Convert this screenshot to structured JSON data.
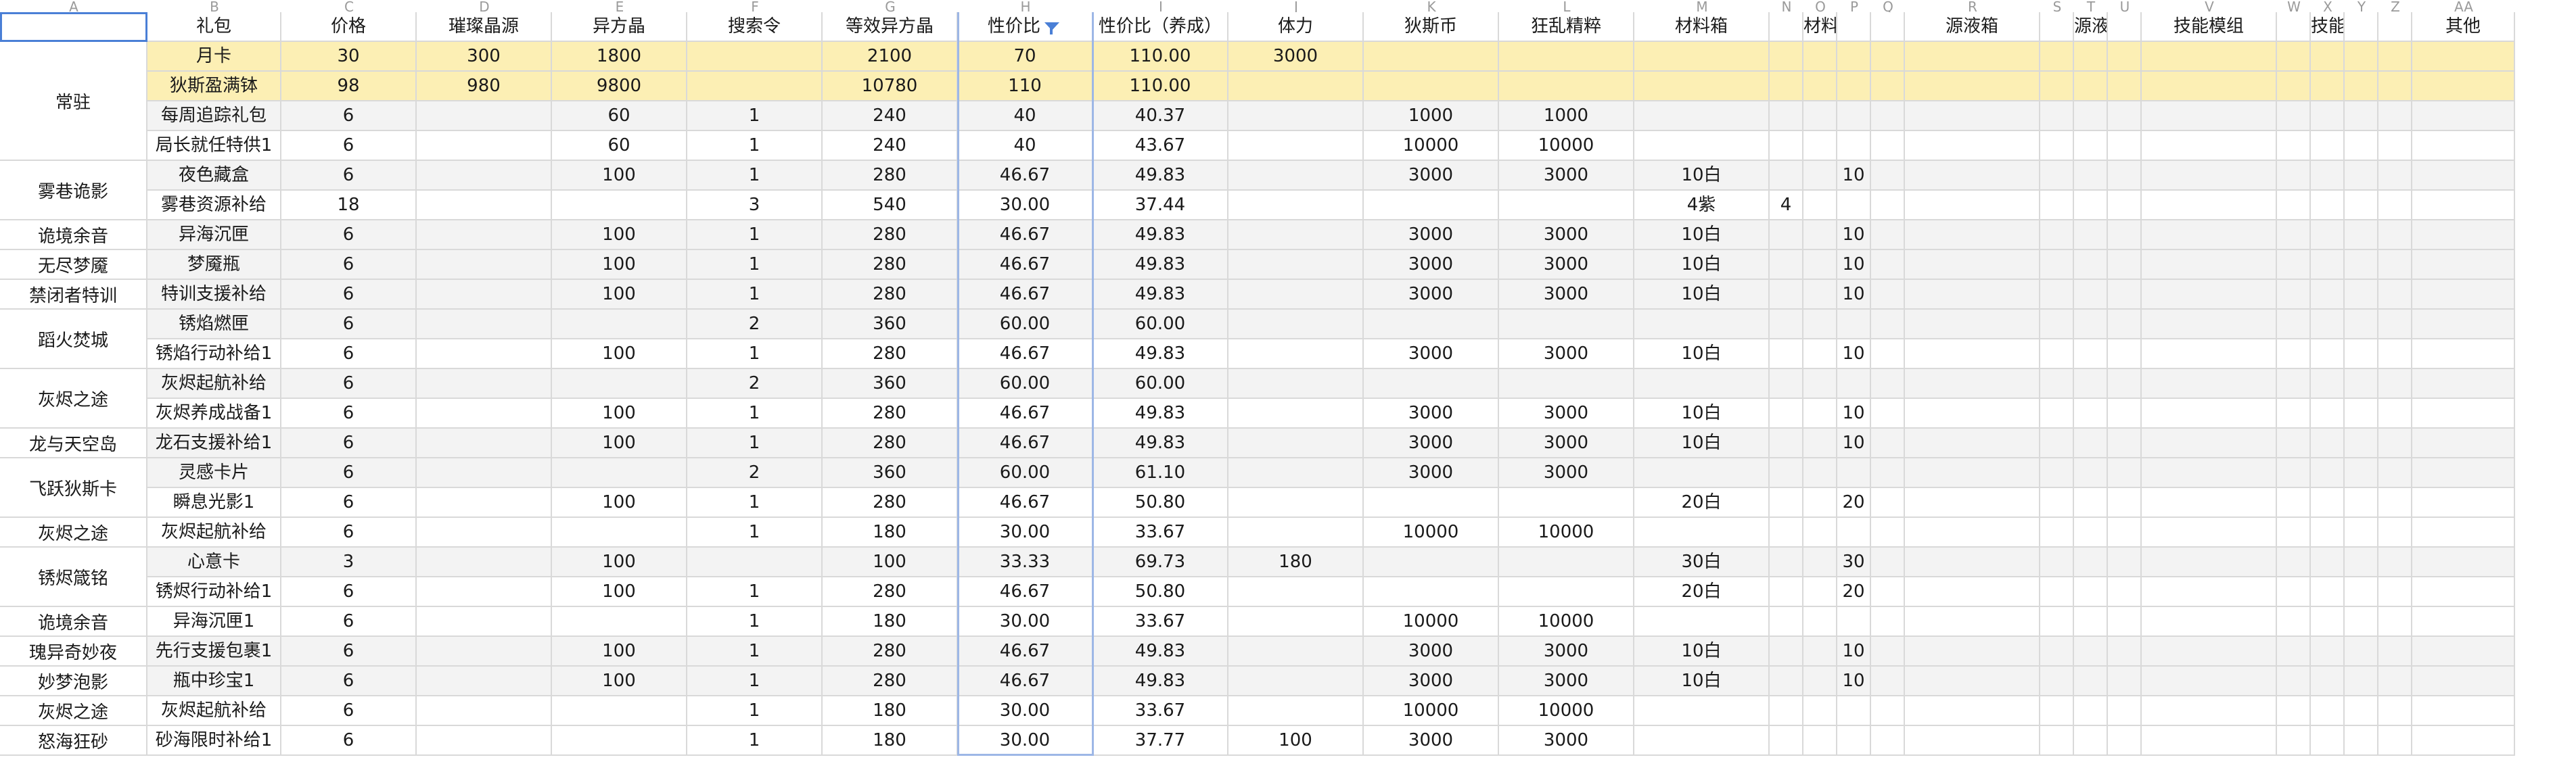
{
  "column_letters": [
    "A",
    "B",
    "C",
    "D",
    "E",
    "F",
    "G",
    "H",
    "I",
    "J",
    "K",
    "L",
    "M",
    "N",
    "O",
    "P",
    "Q",
    "R",
    "S",
    "T",
    "U",
    "V",
    "W",
    "X",
    "Y",
    "Z",
    "AA"
  ],
  "header": [
    "",
    "礼包",
    "价格",
    "璀璨晶源",
    "异方晶",
    "搜索令",
    "等效异方晶",
    "性价比",
    "性价比（养成）",
    "体力",
    "狄斯币",
    "狂乱精粹",
    "材料箱",
    "",
    "材料箱",
    "",
    "",
    "源液箱",
    "",
    "源液箱",
    "",
    "技能模组",
    "",
    "技能模组",
    "",
    "",
    "其他"
  ],
  "filter_column_name": "filter-icon",
  "groups": [
    {
      "label": "常驻",
      "start": 0,
      "span": 4
    },
    {
      "label": "雾巷诡影",
      "start": 4,
      "span": 2
    },
    {
      "label": "诡境余音",
      "start": 6,
      "span": 1
    },
    {
      "label": "无尽梦魇",
      "start": 7,
      "span": 1
    },
    {
      "label": "禁闭者特训",
      "start": 8,
      "span": 1
    },
    {
      "label": "蹈火焚城",
      "start": 9,
      "span": 2
    },
    {
      "label": "灰烬之途",
      "start": 11,
      "span": 2
    },
    {
      "label": "龙与天空岛",
      "start": 13,
      "span": 1
    },
    {
      "label": "飞跃狄斯卡",
      "start": 14,
      "span": 2
    },
    {
      "label": "灰烬之途",
      "start": 16,
      "span": 1
    },
    {
      "label": "锈烬箴铭",
      "start": 17,
      "span": 2
    },
    {
      "label": "诡境余音",
      "start": 19,
      "span": 1
    },
    {
      "label": "瑰异奇妙夜",
      "start": 20,
      "span": 1
    },
    {
      "label": "妙梦泡影",
      "start": 21,
      "span": 1
    },
    {
      "label": "灰烬之途",
      "start": 22,
      "span": 1
    },
    {
      "label": "怒海狂砂",
      "start": 23,
      "span": 1
    }
  ],
  "rows": [
    {
      "style": "yellow",
      "cells": [
        "月卡",
        "30",
        "300",
        "1800",
        "",
        "2100",
        "70",
        "110.00",
        "3000",
        "",
        "",
        "",
        "",
        "",
        "",
        "",
        "",
        "",
        "",
        "",
        "",
        "",
        "",
        "",
        "",
        ""
      ]
    },
    {
      "style": "yellow",
      "cells": [
        "狄斯盈满钵",
        "98",
        "980",
        "9800",
        "",
        "10780",
        "110",
        "110.00",
        "",
        "",
        "",
        "",
        "",
        "",
        "",
        "",
        "",
        "",
        "",
        "",
        "",
        "",
        "",
        "",
        "",
        ""
      ]
    },
    {
      "style": "gray",
      "cells": [
        "每周追踪礼包",
        "6",
        "",
        "60",
        "1",
        "240",
        "40",
        "40.37",
        "",
        "1000",
        "1000",
        "",
        "",
        "",
        "",
        "",
        "",
        "",
        "",
        "",
        "",
        "",
        "",
        "",
        "",
        ""
      ]
    },
    {
      "style": "white",
      "cells": [
        "局长就任特供1",
        "6",
        "",
        "60",
        "1",
        "240",
        "40",
        "43.67",
        "",
        "10000",
        "10000",
        "",
        "",
        "",
        "",
        "",
        "",
        "",
        "",
        "",
        "",
        "",
        "",
        "",
        "",
        ""
      ]
    },
    {
      "style": "gray",
      "cells": [
        "夜色藏盒",
        "6",
        "",
        "100",
        "1",
        "280",
        "46.67",
        "49.83",
        "",
        "3000",
        "3000",
        "10白",
        "",
        "",
        "10",
        "",
        "",
        "",
        "",
        "",
        "",
        "",
        "",
        "",
        "",
        ""
      ]
    },
    {
      "style": "white",
      "cells": [
        "雾巷资源补给",
        "18",
        "",
        "",
        "3",
        "540",
        "30.00",
        "37.44",
        "",
        "",
        "",
        "4紫",
        "4",
        "",
        "",
        "",
        "",
        "",
        "",
        "",
        "",
        "",
        "",
        "",
        "",
        ""
      ]
    },
    {
      "style": "gray",
      "cells": [
        "异海沉匣",
        "6",
        "",
        "100",
        "1",
        "280",
        "46.67",
        "49.83",
        "",
        "3000",
        "3000",
        "10白",
        "",
        "",
        "10",
        "",
        "",
        "",
        "",
        "",
        "",
        "",
        "",
        "",
        "",
        ""
      ]
    },
    {
      "style": "gray",
      "cells": [
        "梦魇瓶",
        "6",
        "",
        "100",
        "1",
        "280",
        "46.67",
        "49.83",
        "",
        "3000",
        "3000",
        "10白",
        "",
        "",
        "10",
        "",
        "",
        "",
        "",
        "",
        "",
        "",
        "",
        "",
        "",
        ""
      ]
    },
    {
      "style": "gray",
      "cells": [
        "特训支援补给",
        "6",
        "",
        "100",
        "1",
        "280",
        "46.67",
        "49.83",
        "",
        "3000",
        "3000",
        "10白",
        "",
        "",
        "10",
        "",
        "",
        "",
        "",
        "",
        "",
        "",
        "",
        "",
        "",
        ""
      ]
    },
    {
      "style": "gray",
      "cells": [
        "锈焰燃匣",
        "6",
        "",
        "",
        "2",
        "360",
        "60.00",
        "60.00",
        "",
        "",
        "",
        "",
        "",
        "",
        "",
        "",
        "",
        "",
        "",
        "",
        "",
        "",
        "",
        "",
        "",
        ""
      ]
    },
    {
      "style": "white",
      "cells": [
        "锈焰行动补给1",
        "6",
        "",
        "100",
        "1",
        "280",
        "46.67",
        "49.83",
        "",
        "3000",
        "3000",
        "10白",
        "",
        "",
        "10",
        "",
        "",
        "",
        "",
        "",
        "",
        "",
        "",
        "",
        "",
        ""
      ]
    },
    {
      "style": "gray",
      "cells": [
        "灰烬起航补给",
        "6",
        "",
        "",
        "2",
        "360",
        "60.00",
        "60.00",
        "",
        "",
        "",
        "",
        "",
        "",
        "",
        "",
        "",
        "",
        "",
        "",
        "",
        "",
        "",
        "",
        "",
        ""
      ]
    },
    {
      "style": "white",
      "cells": [
        "灰烬养成战备1",
        "6",
        "",
        "100",
        "1",
        "280",
        "46.67",
        "49.83",
        "",
        "3000",
        "3000",
        "10白",
        "",
        "",
        "10",
        "",
        "",
        "",
        "",
        "",
        "",
        "",
        "",
        "",
        "",
        ""
      ]
    },
    {
      "style": "gray",
      "cells": [
        "龙石支援补给1",
        "6",
        "",
        "100",
        "1",
        "280",
        "46.67",
        "49.83",
        "",
        "3000",
        "3000",
        "10白",
        "",
        "",
        "10",
        "",
        "",
        "",
        "",
        "",
        "",
        "",
        "",
        "",
        "",
        ""
      ]
    },
    {
      "style": "gray",
      "cells": [
        "灵感卡片",
        "6",
        "",
        "",
        "2",
        "360",
        "60.00",
        "61.10",
        "",
        "3000",
        "3000",
        "",
        "",
        "",
        "",
        "",
        "",
        "",
        "",
        "",
        "",
        "",
        "",
        "",
        "",
        ""
      ]
    },
    {
      "style": "white",
      "cells": [
        "瞬息光影1",
        "6",
        "",
        "100",
        "1",
        "280",
        "46.67",
        "50.80",
        "",
        "",
        "",
        "20白",
        "",
        "",
        "20",
        "",
        "",
        "",
        "",
        "",
        "",
        "",
        "",
        "",
        "",
        ""
      ]
    },
    {
      "style": "white",
      "cells": [
        "灰烬起航补给",
        "6",
        "",
        "",
        "1",
        "180",
        "30.00",
        "33.67",
        "",
        "10000",
        "10000",
        "",
        "",
        "",
        "",
        "",
        "",
        "",
        "",
        "",
        "",
        "",
        "",
        "",
        "",
        ""
      ]
    },
    {
      "style": "gray",
      "cells": [
        "心意卡",
        "3",
        "",
        "100",
        "",
        "100",
        "33.33",
        "69.73",
        "180",
        "",
        "",
        "30白",
        "",
        "",
        "30",
        "",
        "",
        "",
        "",
        "",
        "",
        "",
        "",
        "",
        "",
        ""
      ]
    },
    {
      "style": "white",
      "cells": [
        "锈烬行动补给1",
        "6",
        "",
        "100",
        "1",
        "280",
        "46.67",
        "50.80",
        "",
        "",
        "",
        "20白",
        "",
        "",
        "20",
        "",
        "",
        "",
        "",
        "",
        "",
        "",
        "",
        "",
        "",
        ""
      ]
    },
    {
      "style": "white",
      "cells": [
        "异海沉匣1",
        "6",
        "",
        "",
        "1",
        "180",
        "30.00",
        "33.67",
        "",
        "10000",
        "10000",
        "",
        "",
        "",
        "",
        "",
        "",
        "",
        "",
        "",
        "",
        "",
        "",
        "",
        "",
        ""
      ]
    },
    {
      "style": "gray",
      "cells": [
        "先行支援包裹1",
        "6",
        "",
        "100",
        "1",
        "280",
        "46.67",
        "49.83",
        "",
        "3000",
        "3000",
        "10白",
        "",
        "",
        "10",
        "",
        "",
        "",
        "",
        "",
        "",
        "",
        "",
        "",
        "",
        ""
      ]
    },
    {
      "style": "gray",
      "cells": [
        "瓶中珍宝1",
        "6",
        "",
        "100",
        "1",
        "280",
        "46.67",
        "49.83",
        "",
        "3000",
        "3000",
        "10白",
        "",
        "",
        "10",
        "",
        "",
        "",
        "",
        "",
        "",
        "",
        "",
        "",
        "",
        ""
      ]
    },
    {
      "style": "white",
      "cells": [
        "灰烬起航补给",
        "6",
        "",
        "",
        "1",
        "180",
        "30.00",
        "33.67",
        "",
        "10000",
        "10000",
        "",
        "",
        "",
        "",
        "",
        "",
        "",
        "",
        "",
        "",
        "",
        "",
        "",
        "",
        ""
      ]
    },
    {
      "style": "white",
      "cells": [
        "砂海限时补给1",
        "6",
        "",
        "",
        "1",
        "180",
        "30.00",
        "37.77",
        "100",
        "3000",
        "3000",
        "",
        "",
        "",
        "",
        "",
        "",
        "",
        "",
        "",
        "",
        "",
        "",
        "",
        "",
        ""
      ]
    }
  ]
}
